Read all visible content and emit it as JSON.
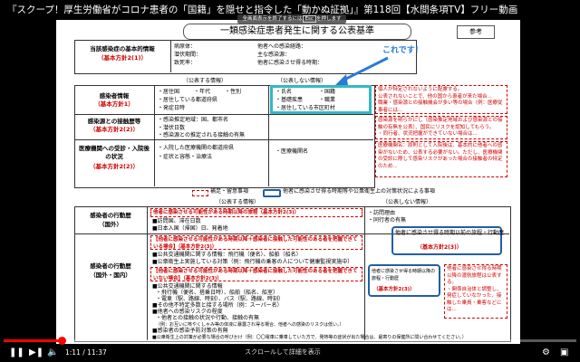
{
  "video": {
    "title": "『スクープ！厚生労働省がコロナ患者の「国籍」を隠せと指令した「動かぬ証拠」』第118回【水間条項TV】フリー動画",
    "esc_toast_prefix": "全画面表示を終了するには",
    "esc_key": "Esc",
    "esc_toast_suffix": "を押します",
    "time": "1:11 / 11:37",
    "progress_fraction": 0.102,
    "scroll_hint": "スクロールして詳細を表示",
    "accent_color": "#ff0000"
  },
  "doc": {
    "title": "一類感染症患者発生に関する公表基準",
    "ref_label": "参考",
    "callout": "これです！",
    "top": {
      "label": "当該感染症の基本的情報",
      "tag": "（基本方針2(1)）",
      "l1": "病原体：",
      "l2": "潜伏期間：",
      "l3": "致死率：",
      "r1": "他者への感染経路：",
      "r2": "主な感染源：",
      "r3": "他者に感染させ得る時期："
    },
    "headers": {
      "public": "（公表する情報）",
      "nonpublic": "（公表しない情報）"
    },
    "row1": {
      "label": "感染者情報",
      "tag": "（基本方針1）",
      "p1": "・居住国",
      "p1b": "・年代",
      "p1c": "・性別",
      "p2": "・居住している都道府県",
      "p3": "・発症日時",
      "n1": "・氏名",
      "n1b": "・国籍",
      "n2": "・基礎疾患",
      "n2b": "・職業",
      "n3": "・居住している市区町村",
      "note": "個人が特定されないように配慮する。\n公表されないことで、他の国から患者が来た場合...\n職業・感染源との接触機会が多い等の場合（例：医療従事者には...\n基礎疾患の有無に関しては、個人が特定されないよう配慮...\n居住している市区町村：市区町村が公表する場合を除き公表しない"
    },
    "row2": {
      "label": "感染源との接触歴等",
      "tag": "（基本方針2(2)）",
      "p1": "・感染推定地域：国、都市名",
      "p2": "・潜伏日数",
      "p3": "・感染源との推定される接触の有無",
      "note": "感染源を明らかにし（感染推定地域および感染源との接触の有無を公表）、国民にリスクを認知してもらう。\n・同行者、状況把握ができていない場合は..."
    },
    "row3": {
      "label": "医療機関への受診・入院後の状況",
      "tag": "（基本方針2(2)）",
      "p1": "・入院した医療機関の都道府県",
      "p2": "・症状と容態・治療法",
      "n1": "・医療機関名",
      "note": "医療機関名：原則として入院後は、基本的に他者への感染がないため、公表する必要がない。ただし、医療機関の受診に際して感染リスクがあった場合の接触者の特定のため..."
    },
    "legend": {
      "red": "補足・留意事項",
      "blue": "他者に感染させ得る時期等や公衆衛生上の対策状況による事項"
    },
    "headers2": {
      "public": "（公表する情報）",
      "nonpublic": "（公表しない情報）"
    },
    "row4": {
      "label": "感染者の行動歴",
      "label2": "（国外）",
      "red1": "他者に感染させる可能性がある時期以降の旅程（基本方針2(3)）",
      "p1": "■訪問国、滞在日数",
      "p2": "■日本入国（帰国）日、発着地",
      "n1": "・訪問理由",
      "n2": "・同行者の有無",
      "blue1": "他者に感染させ得る時期以前の旅程・行動歴",
      "blue1tag": "（基本方針2(3)）"
    },
    "row5": {
      "label": "感染者の行動歴",
      "label2": "（国外・国内）",
      "red1": "【他者に感染させる可能性がある時期以降＋感染者に接触した可能性のある者を把握できている場合】（基本方針2(3)）",
      "p1": "■公共交通機関に関する情報：飛行機（便名）、船舶（船名）",
      "p2": "■公衆衛生上実施している対策（例：飛行機の乗客の人について健康監視実施中）",
      "red2": "【他者に感染させる可能性がある時期以降＋感染者に接触した可能性のある者を把握できていない場合】（基本方針2(3)）",
      "p3": "■公共交通機関に関する情報",
      "p4": "・飛行機（便名、搭乗日時）、船舶（船名、船室）",
      "p5": "・電車（駅、路線、時刻）、バス（駅、路線、時刻）",
      "p6": "■その他不特定多数と接する場所（例：スーパー名）",
      "p7": "■他者への感染リスクの程度",
      "p8": "・他者との接触の状況や行動、接触の有無",
      "p9": "（例：お互いに咳やくしゃみ等の体液に暴露され得る場合、他者への感染のリスクは低い。）",
      "p10": "■感染者の感染予防対策の有無",
      "p11": "■公衆衛生上の対策が必要な場合の呼びかけ（例：〇〇電車に乗車していた方で、発熱等の症状が出た場合は、最寄りの保健所に問い合わせてください。）",
      "blue2": "他者に感染させ得る時期以降の旅程・行動歴",
      "blue2tag": "（基本方針2(3)）",
      "note": "他者に感染させ得る時期以降の渡航旅程は公表する。\n・関係自治体と調整し、発症していなかった、接触した乗員・乗客などには..."
    }
  }
}
